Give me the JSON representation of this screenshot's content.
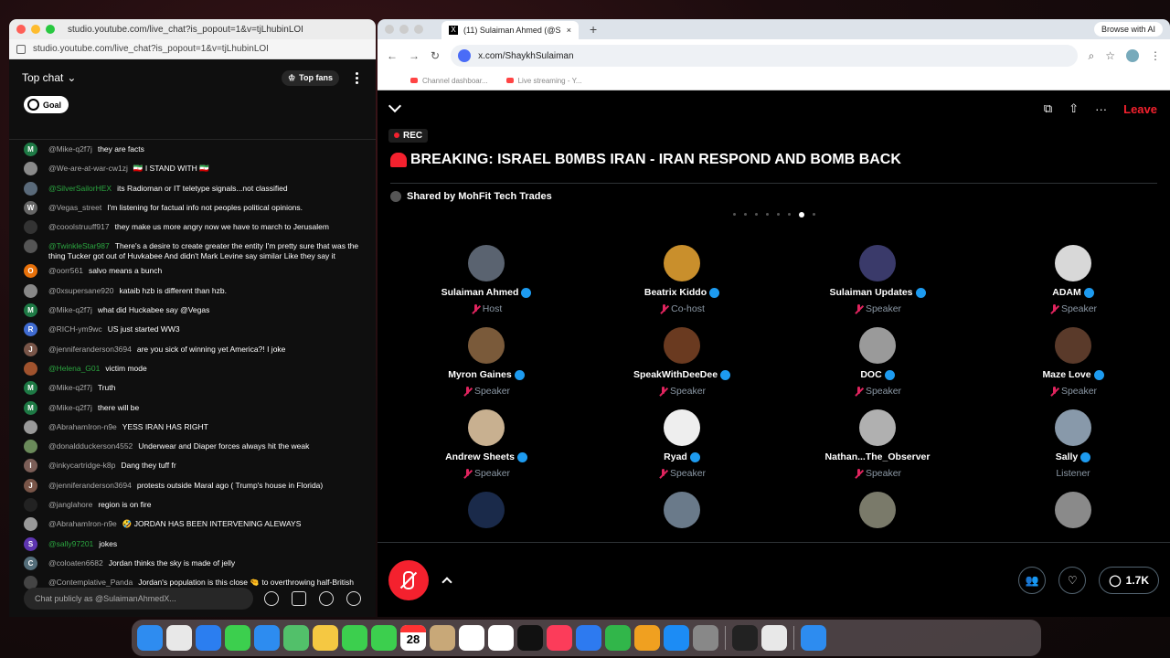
{
  "chat_window": {
    "title": "studio.youtube.com/live_chat?is_popout=1&v=tjLhubinLOI",
    "url": "studio.youtube.com/live_chat?is_popout=1&v=tjLhubinLOI",
    "header_label": "Top chat",
    "top_fans_label": "Top fans",
    "goal_label": "Goal",
    "input_placeholder": "Chat publicly as @SulaimanAhmedX...",
    "messages": [
      {
        "user": "@Mike-q2f7j",
        "text": "they are facts",
        "avatar": "M",
        "color": "#1e7a45",
        "green": false
      },
      {
        "user": "@We-are-at-war-cw1zj",
        "text": "🇮🇷 I STAND WITH 🇮🇷",
        "avatar": "",
        "color": "#8a8a8a",
        "green": false
      },
      {
        "user": "@SilverSailorHEX",
        "text": "its Radioman or IT teletype signals...not classified",
        "avatar": "",
        "color": "#5a6a7a",
        "green": true
      },
      {
        "user": "@Vegas_street",
        "text": "I'm listening for factual info not peoples political opinions.",
        "avatar": "W",
        "color": "#666",
        "green": false
      },
      {
        "user": "@cooolstruuff917",
        "text": "they make us more angry now we have to march to Jerusalem",
        "avatar": "",
        "color": "#333",
        "green": false
      },
      {
        "user": "@TwinkleStar987",
        "text": "There's a desire to create greater the entity I'm pretty sure that was the thing Tucker got out of Huvkabee And didn't Mark Levine say similar Like they say it",
        "avatar": "",
        "color": "#555",
        "green": true
      },
      {
        "user": "@oorr561",
        "text": "salvo means a bunch",
        "avatar": "O",
        "color": "#e8710a",
        "green": false
      },
      {
        "user": "@0xsupersane920",
        "text": "kataib hzb is different than hzb.",
        "avatar": "",
        "color": "#888",
        "green": false
      },
      {
        "user": "@Mike-q2f7j",
        "text": "what did Huckabee say @Vegas",
        "avatar": "M",
        "color": "#1e7a45",
        "green": false
      },
      {
        "user": "@RICH-ym9wc",
        "text": "US just started WW3",
        "avatar": "R",
        "color": "#3f6bd1",
        "green": false
      },
      {
        "user": "@jenniferanderson3694",
        "text": "are you sick of winning yet America?! I joke",
        "avatar": "J",
        "color": "#795548",
        "green": false
      },
      {
        "user": "@Helena_G01",
        "text": "victim mode",
        "avatar": "",
        "color": "#a0522d",
        "green": true
      },
      {
        "user": "@Mike-q2f7j",
        "text": "Truth",
        "avatar": "M",
        "color": "#1e7a45",
        "green": false
      },
      {
        "user": "@Mike-q2f7j",
        "text": "there will be",
        "avatar": "M",
        "color": "#1e7a45",
        "green": false
      },
      {
        "user": "@AbrahamIron-n9e",
        "text": "YESS IRAN HAS RIGHT",
        "avatar": "",
        "color": "#999",
        "green": false
      },
      {
        "user": "@donaldduckerson4552",
        "text": "Underwear and Diaper forces always hit the weak",
        "avatar": "",
        "color": "#6a8a5a",
        "green": false
      },
      {
        "user": "@inkycartridge-k8p",
        "text": "Dang they tuff fr",
        "avatar": "I",
        "color": "#7b5e57",
        "green": false
      },
      {
        "user": "@jenniferanderson3694",
        "text": "protests outside Maral ago ( Trump's house in Florida)",
        "avatar": "J",
        "color": "#795548",
        "green": false
      },
      {
        "user": "@janglahore",
        "text": "region is on fire",
        "avatar": "",
        "color": "#222",
        "green": false
      },
      {
        "user": "@AbrahamIron-n9e",
        "text": "🤣 JORDAN HAS BEEN INTERVENING ALEWAYS",
        "avatar": "",
        "color": "#999",
        "green": false
      },
      {
        "user": "@sally97201",
        "text": "jokes",
        "avatar": "S",
        "color": "#5e35b1",
        "green": true
      },
      {
        "user": "@coloaten6682",
        "text": "Jordan thinks the sky is made of jelly",
        "avatar": "C",
        "color": "#546e7a",
        "green": false
      },
      {
        "user": "@Contemplative_Panda",
        "text": "Jordan's population is this close 🤏 to overthrowing half-British king",
        "avatar": "",
        "color": "#444",
        "green": false
      }
    ]
  },
  "x_window": {
    "tab_title": "(11) Sulaiman Ahmed (@S",
    "browse_ai": "Browse with AI",
    "address": "x.com/ShaykhSulaiman",
    "bookmarks": [
      "Channel dashboar...",
      "Live streaming - Y..."
    ],
    "leave_label": "Leave",
    "rec_label": "REC",
    "space_title": "BREAKING: ISRAEL B0MBS IRAN - IRAN RESPOND AND BOMB BACK",
    "shared_by": "Shared by MohFit Tech Trades",
    "participants": [
      {
        "name": "Sulaiman Ahmed",
        "role": "Host",
        "verified": true,
        "color": "#5a6370"
      },
      {
        "name": "Beatrix Kiddo",
        "role": "Co-host",
        "verified": true,
        "color": "#c98f2c"
      },
      {
        "name": "Sulaiman Updates",
        "role": "Speaker",
        "verified": true,
        "color": "#3a3a6a"
      },
      {
        "name": "ADAM",
        "role": "Speaker",
        "verified": true,
        "color": "#d8d8d8"
      },
      {
        "name": "Myron Gaines",
        "role": "Speaker",
        "verified": true,
        "color": "#7a5a3a"
      },
      {
        "name": "SpeakWithDeeDee",
        "role": "Speaker",
        "verified": true,
        "color": "#6a3a20"
      },
      {
        "name": "DOC",
        "role": "Speaker",
        "verified": true,
        "color": "#9a9a9a"
      },
      {
        "name": "Maze Love",
        "role": "Speaker",
        "verified": true,
        "color": "#5a3a2a"
      },
      {
        "name": "Andrew Sheets",
        "role": "Speaker",
        "verified": true,
        "color": "#c8b090"
      },
      {
        "name": "Ryad",
        "role": "Speaker",
        "verified": true,
        "color": "#eeeeee"
      },
      {
        "name": "Nathan...The_Observer",
        "role": "Speaker",
        "verified": false,
        "color": "#b0b0b0"
      },
      {
        "name": "Sally",
        "role": "Listener",
        "verified": true,
        "color": "#8899aa"
      },
      {
        "name": "",
        "role": "",
        "verified": false,
        "color": "#1a2a4a"
      },
      {
        "name": "",
        "role": "",
        "verified": false,
        "color": "#6a7a8a"
      },
      {
        "name": "",
        "role": "",
        "verified": false,
        "color": "#7a7a6a"
      },
      {
        "name": "",
        "role": "",
        "verified": false,
        "color": "#8a8a8a"
      }
    ],
    "replies_count": "1.7K"
  },
  "dock": {
    "calendar_day": "28",
    "apps": [
      "finder-icon",
      "launchpad-icon",
      "safari-icon",
      "messages-icon",
      "mail-icon",
      "maps-icon",
      "photos-icon",
      "facetime-icon",
      "phone-icon",
      "calendar-icon",
      "contacts-icon",
      "reminders-icon",
      "notes-icon",
      "tv-icon",
      "music-icon",
      "keynote-icon",
      "numbers-icon",
      "pages-icon",
      "app-store-icon",
      "settings-icon",
      "activity-monitor-icon",
      "chrome-icon",
      "other-icon"
    ]
  }
}
